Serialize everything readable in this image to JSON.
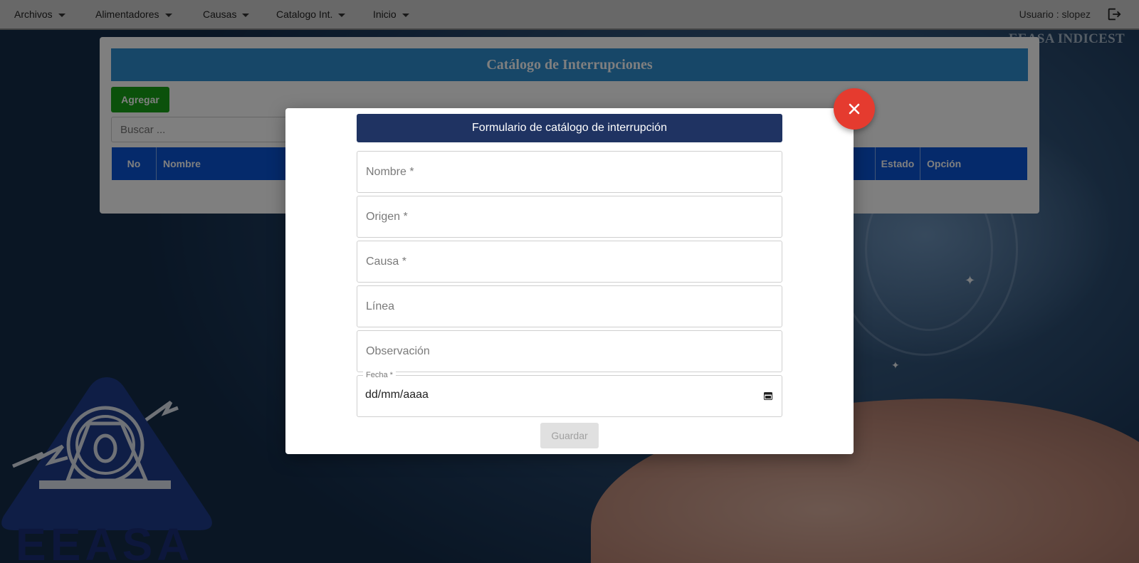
{
  "nav": {
    "items": [
      {
        "label": "Archivos"
      },
      {
        "label": "Alimentadores"
      },
      {
        "label": "Causas"
      },
      {
        "label": "Catalogo Int."
      },
      {
        "label": "Inicio"
      }
    ],
    "user_label": "Usuario : slopez",
    "logout_icon": "logout-icon"
  },
  "brand": "EEASA INDICEST",
  "logo_text": "EEASA",
  "panel": {
    "title": "Catálogo de Interrupciones",
    "add_label": "Agregar",
    "search_placeholder": "Buscar ...",
    "columns": {
      "no": "No",
      "nombre": "Nombre",
      "estado": "Estado",
      "opcion": "Opción"
    }
  },
  "modal": {
    "title": "Formulario de catálogo de interrupción",
    "fields": {
      "nombre": "Nombre *",
      "origen": "Origen *",
      "causa": "Causa *",
      "linea": "Línea",
      "observacion": "Observación"
    },
    "fecha": {
      "label": "Fecha *",
      "value": "dd/mm/aaaa"
    },
    "save_label": "Guardar",
    "close_icon": "close-icon"
  },
  "colors": {
    "modal_title_bg": "#1f3362",
    "panel_header_bg": "#2f8fd0",
    "table_head_bg": "#0a55d6",
    "add_button": "#17a317",
    "close_button": "#e53b2f"
  }
}
